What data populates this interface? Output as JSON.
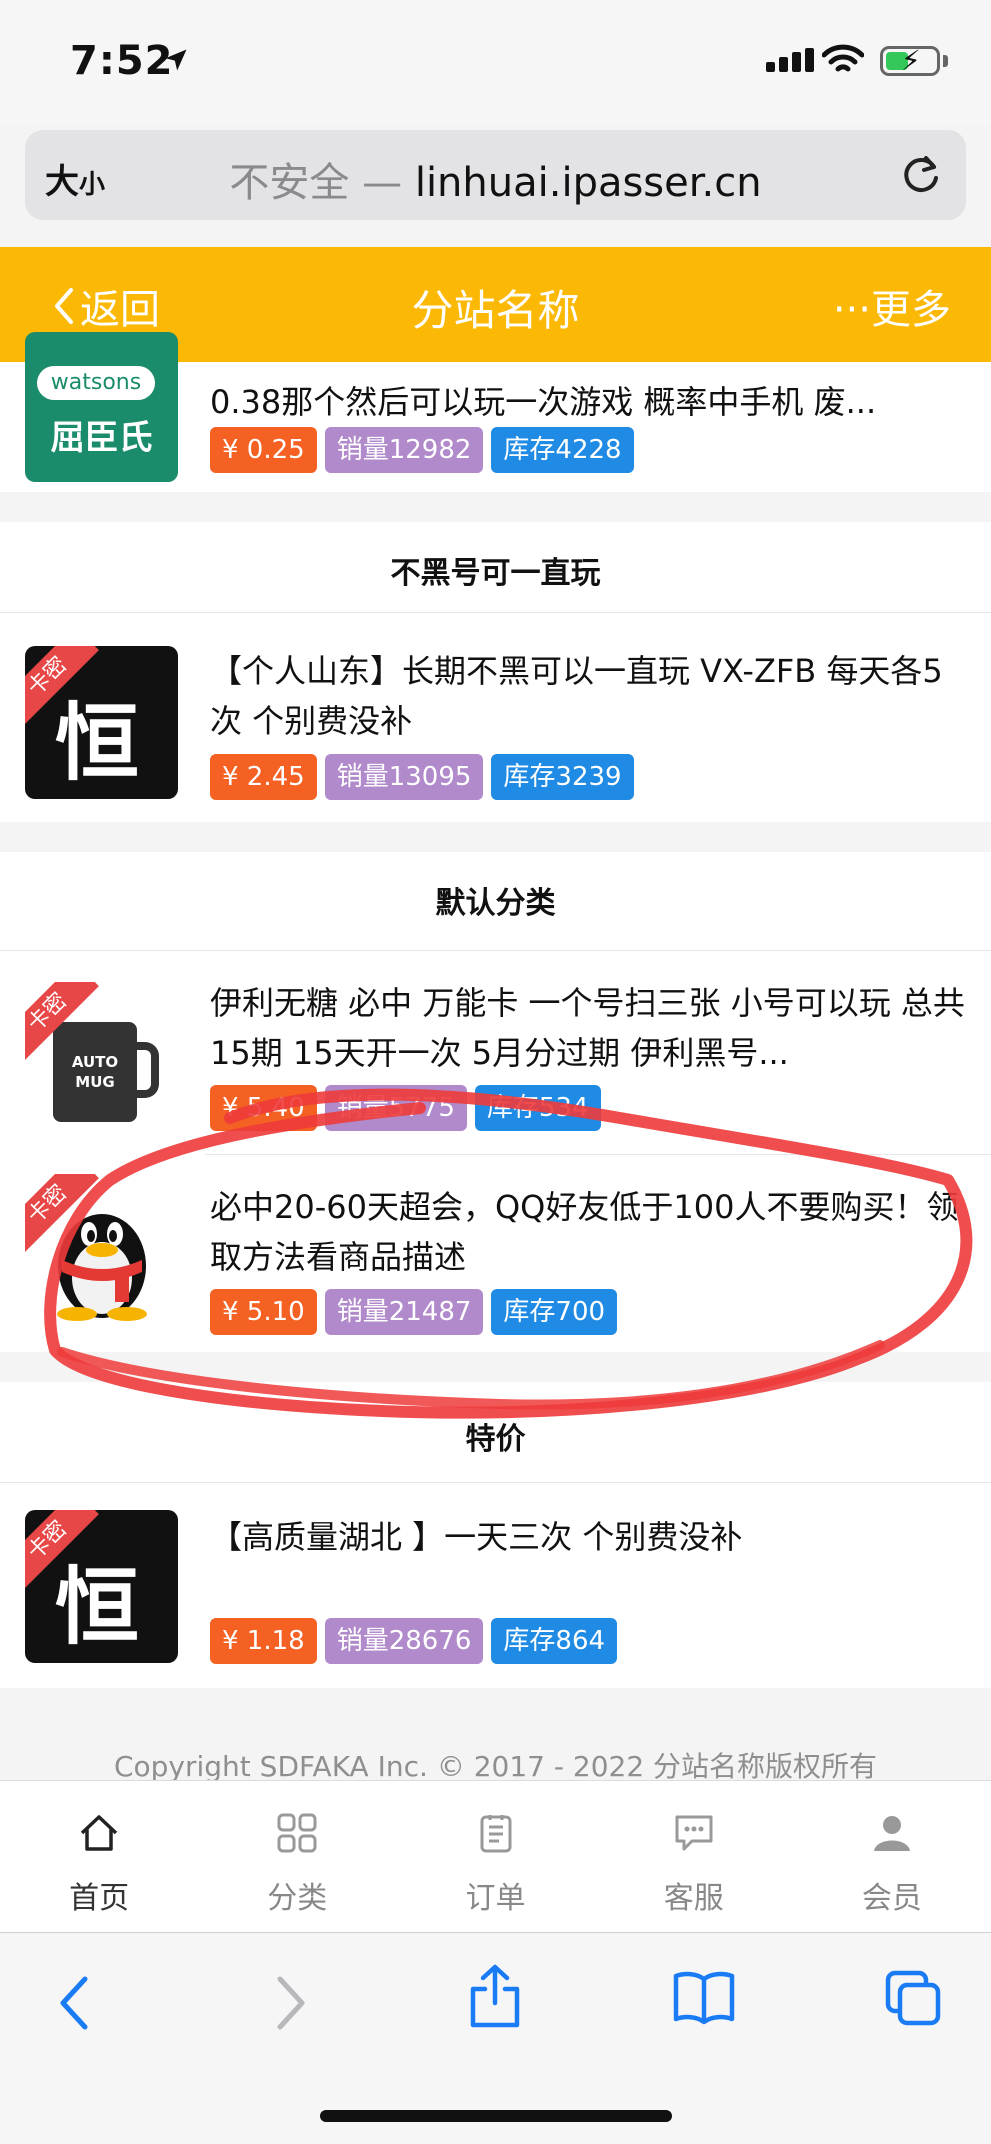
{
  "status_bar": {
    "time": "7:52"
  },
  "address_bar": {
    "text_size_label": "大",
    "text_size_small": "小",
    "insecure_label": "不安全",
    "separator": "—",
    "domain": "linhuai.ipasser.cn"
  },
  "header": {
    "back_label": "返回",
    "title": "分站名称",
    "more_label": "更多"
  },
  "sections": [
    {
      "title": "",
      "items": [
        {
          "title": "0.38那个然后可以玩一次游戏 概率中手机 废...",
          "price": "¥ 0.25",
          "sales": "销量12982",
          "stock": "库存4228",
          "thumb_brand": "watsons",
          "thumb_text": "屈臣氏",
          "ribbon": ""
        }
      ]
    },
    {
      "title": "不黑号可一直玩",
      "items": [
        {
          "title": "【个人山东】长期不黑可以一直玩 VX-ZFB 每天各5次 个别费没补",
          "price": "¥ 2.45",
          "sales": "销量13095",
          "stock": "库存3239",
          "thumb_text": "恒",
          "ribbon": "卡密"
        }
      ]
    },
    {
      "title": "默认分类",
      "items": [
        {
          "title": "伊利无糖 必中 万能卡 一个号扫三张 小号可以玩 总共15期 15天开一次 5月分过期 伊利黑号...",
          "price": "¥ 5.40",
          "sales": "销量5775",
          "stock": "库存534",
          "thumb_text": "AUTO MUG",
          "ribbon": "卡密"
        },
        {
          "title": "必中20-60天超会，QQ好友低于100人不要购买！领取方法看商品描述",
          "price": "¥ 5.10",
          "sales": "销量21487",
          "stock": "库存700",
          "ribbon": "卡密"
        }
      ]
    },
    {
      "title": "特价",
      "items": [
        {
          "title": "【高质量湖北 】一天三次 个别费没补",
          "price": "¥ 1.18",
          "sales": "销量28676",
          "stock": "库存864",
          "thumb_text": "恒",
          "ribbon": "卡密"
        }
      ]
    }
  ],
  "footer": {
    "copyright": "Copyright SDFAKA Inc. © 2017 - 2022 分站名称版权所有"
  },
  "tabbar": [
    {
      "label": "首页",
      "icon": "home-icon",
      "active": true
    },
    {
      "label": "分类",
      "icon": "grid-icon"
    },
    {
      "label": "订单",
      "icon": "order-icon"
    },
    {
      "label": "客服",
      "icon": "chat-icon"
    },
    {
      "label": "会员",
      "icon": "user-icon"
    }
  ],
  "colors": {
    "header": "#fbb805",
    "price": "#f46123",
    "sales": "#b08acb",
    "stock": "#1f8be4",
    "annotation": "#ee3b3b",
    "safari_blue": "#1a7cf5"
  }
}
